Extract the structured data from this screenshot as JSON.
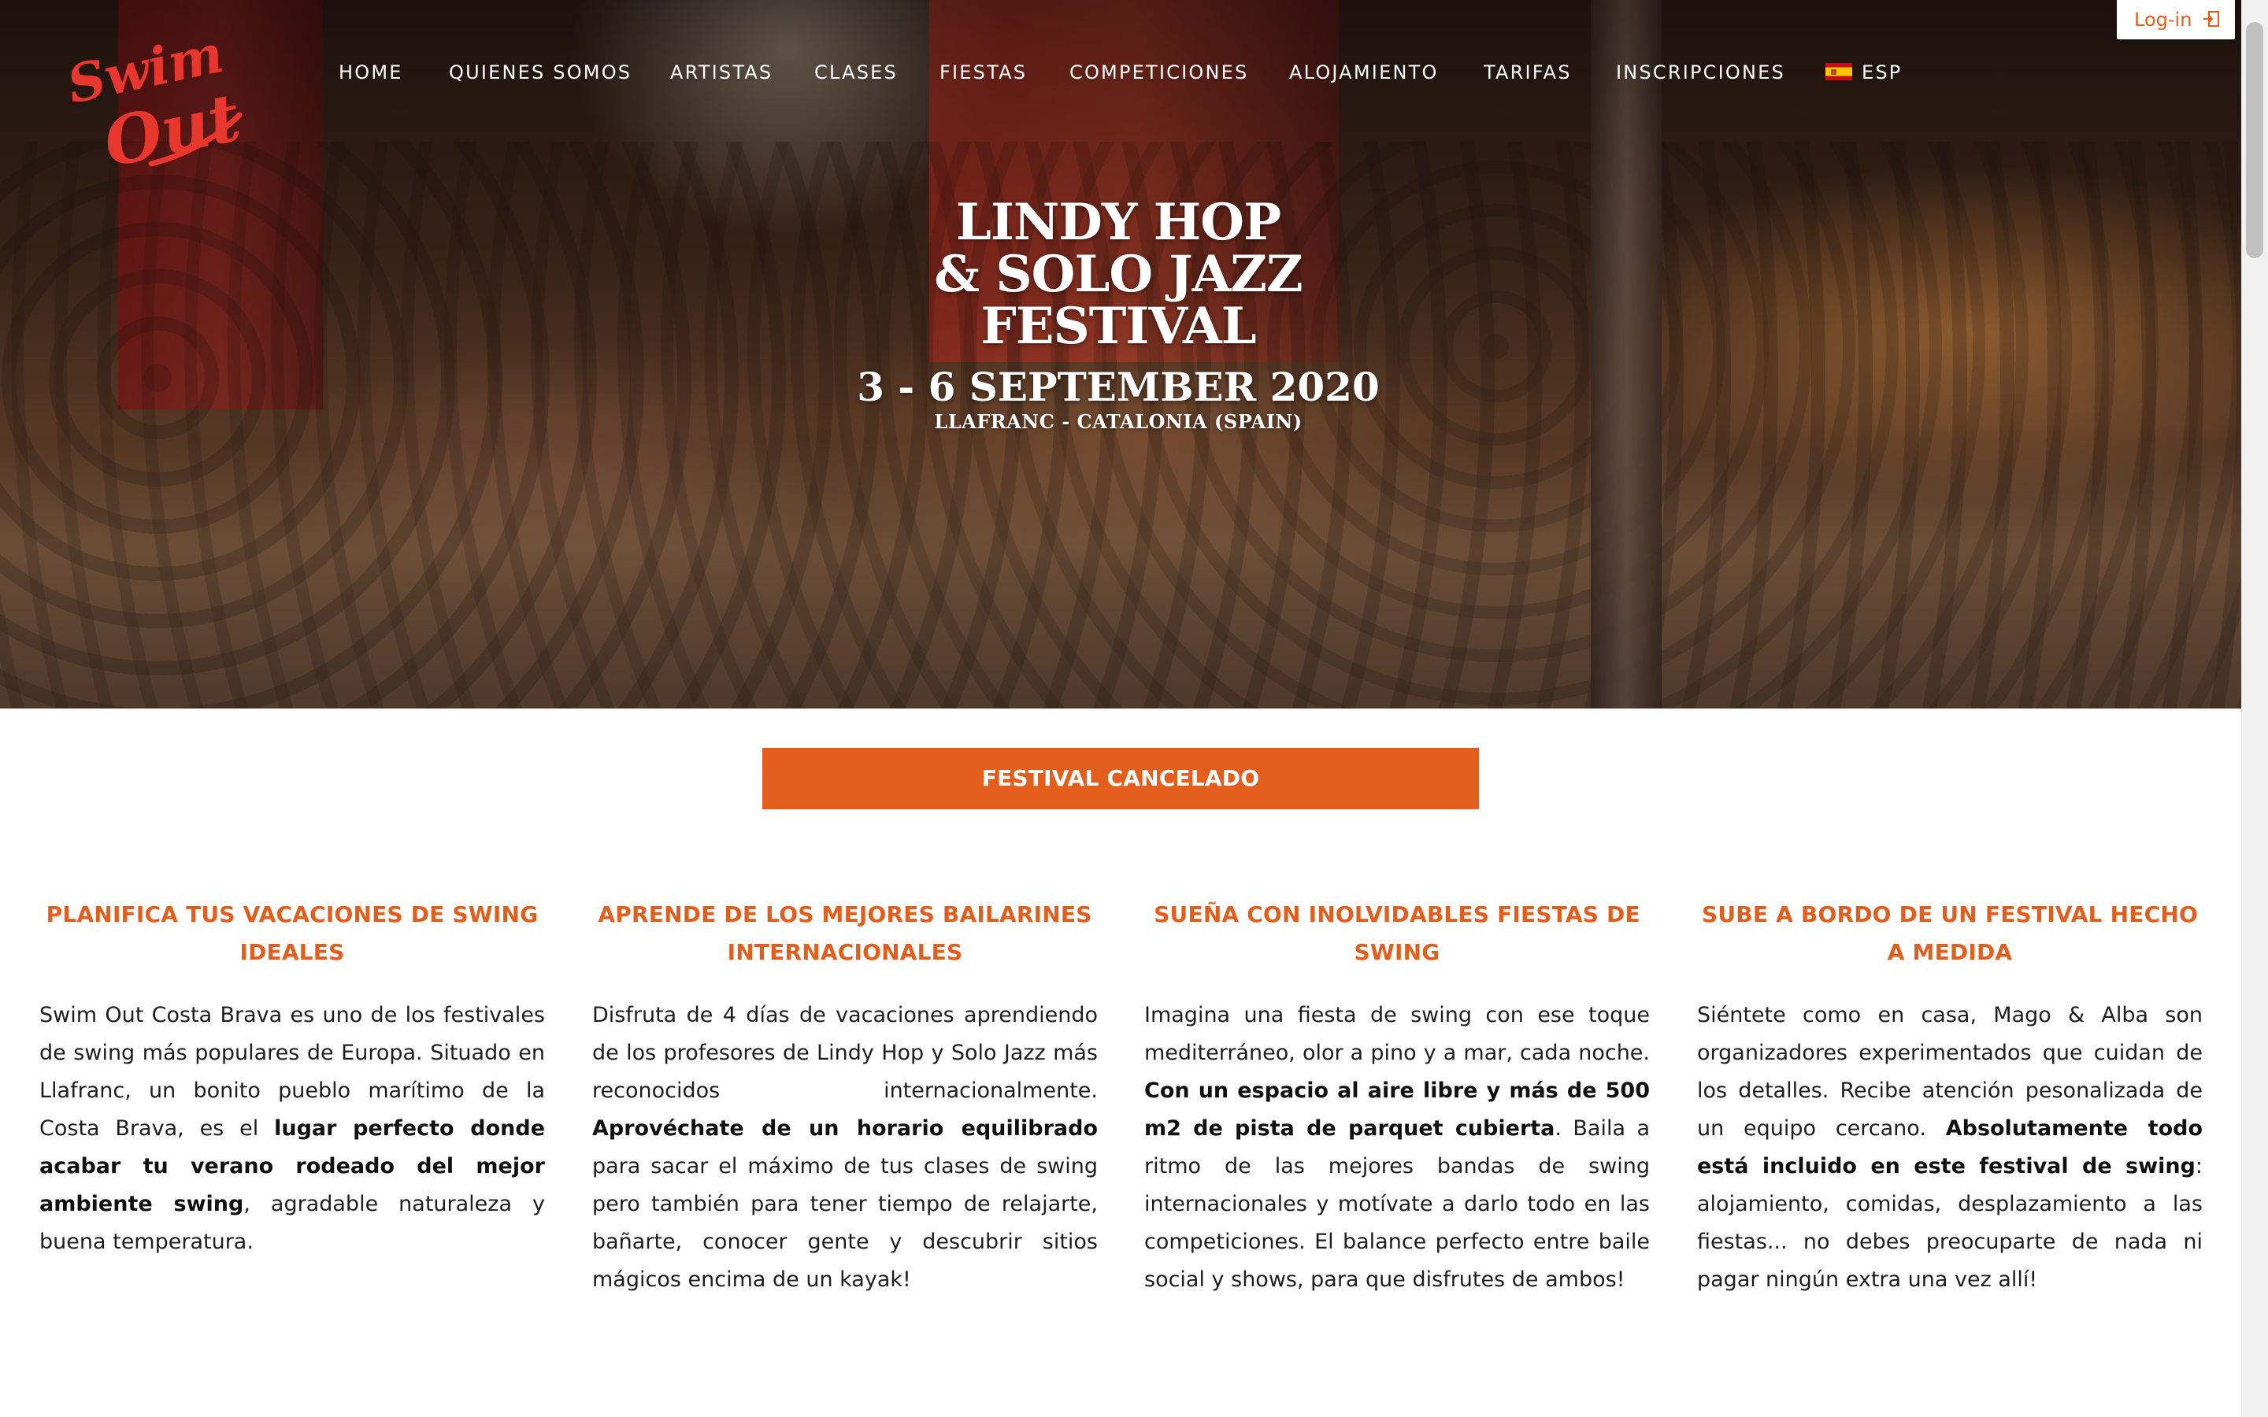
{
  "login": {
    "label": "Log-in"
  },
  "logo": {
    "text_line1": "Swim",
    "text_line2": "Out"
  },
  "nav": {
    "items": [
      {
        "label": "HOME"
      },
      {
        "label": "QUIENES SOMOS"
      },
      {
        "label": "ARTISTAS"
      },
      {
        "label": "CLASES"
      },
      {
        "label": "FIESTAS"
      },
      {
        "label": "COMPETICIONES"
      },
      {
        "label": "ALOJAMIENTO"
      },
      {
        "label": "TARIFAS"
      },
      {
        "label": "INSCRIPCIONES"
      }
    ],
    "language": {
      "label": "ESP",
      "icon": "spain-flag-icon"
    }
  },
  "hero": {
    "line1": "LINDY HOP",
    "line2": "& SOLO JAZZ",
    "line3": "FESTIVAL",
    "date": "3 - 6  SEPTEMBER 2020",
    "place": "LLAFRANC - CATALONIA (SPAIN)"
  },
  "cancel_button": {
    "label": "FESTIVAL CANCELADO"
  },
  "colors": {
    "accent": "#e35e1d",
    "text": "#1e1e1e"
  },
  "columns": [
    {
      "title": "PLANIFICA TUS VACACIONES DE SWING IDEALES",
      "t1": "Swim Out Costa Brava es uno de los festivales de swing más populares de Europa. Situado en Llafranc, un bonito pueblo marítimo de la Costa Brava, es el ",
      "b1": "lugar perfecto donde acabar tu verano rodeado del mejor ambiente swing",
      "t2": ", agradable naturaleza y buena temperatura.",
      "b2": "",
      "t3": ""
    },
    {
      "title": "APRENDE DE LOS MEJORES BAILARINES INTERNACIONALES",
      "t1": "Disfruta de 4 días de vacaciones aprendiendo de los profesores de Lindy Hop y Solo Jazz más reconocidos internacionalmente. ",
      "b1": "Aprovéchate de un horario equilibrado",
      "t2": " para sacar el máximo de tus clases de swing pero también para tener tiempo de relajarte, bañarte, conocer gente y descubrir sitios mágicos encima de un kayak!",
      "b2": "",
      "t3": ""
    },
    {
      "title": "SUEÑA CON INOLVIDABLES FIESTAS DE SWING",
      "t1": "Imagina una fiesta de swing con ese toque mediterráneo, olor a pino y a mar, cada noche. ",
      "b1": "Con un espacio al aire libre y más de 500 m2 de pista de parquet cubierta",
      "t2": ". Baila a ritmo de las mejores bandas de swing internacionales y motívate a darlo todo en las competiciones. El balance perfecto entre baile social y shows, para que disfrutes de ambos!",
      "b2": "",
      "t3": ""
    },
    {
      "title": "SUBE A BORDO DE UN FESTIVAL HECHO A MEDIDA",
      "t1": "Siéntete como en casa, Mago & Alba son organizadores experimentados que cuidan de los detalles. Recibe atención pesonalizada de un equipo cercano. ",
      "b1": "Absolutamente todo está incluido en este festival de swing",
      "t2": ": alojamiento, comidas, desplazamiento a las fiestas... no debes preocuparte de nada ni pagar ningún extra una vez allí!",
      "b2": "",
      "t3": ""
    }
  ]
}
